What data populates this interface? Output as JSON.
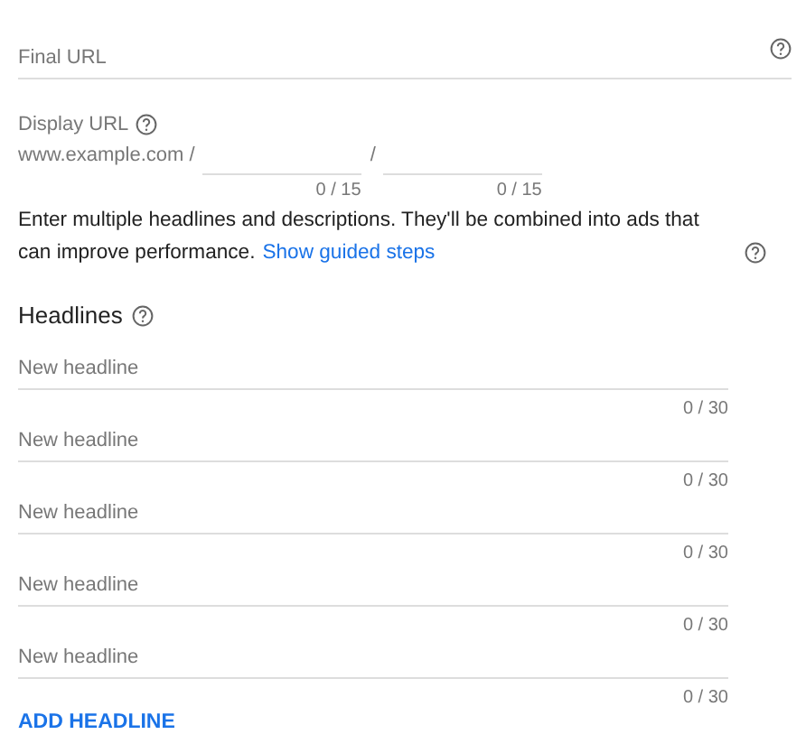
{
  "final_url": {
    "placeholder": "Final URL"
  },
  "display_url": {
    "label": "Display URL",
    "domain": "www.example.com /",
    "separator": "/",
    "paths": [
      {
        "counter": "0 / 15"
      },
      {
        "counter": "0 / 15"
      }
    ]
  },
  "info": {
    "text": "Enter multiple headlines and descriptions. They'll be combined into ads that can improve performance.",
    "link": "Show guided steps"
  },
  "headlines": {
    "title": "Headlines",
    "items": [
      {
        "placeholder": "New headline",
        "counter": "0 / 30"
      },
      {
        "placeholder": "New headline",
        "counter": "0 / 30"
      },
      {
        "placeholder": "New headline",
        "counter": "0 / 30"
      },
      {
        "placeholder": "New headline",
        "counter": "0 / 30"
      },
      {
        "placeholder": "New headline",
        "counter": "0 / 30"
      }
    ],
    "add_button": "ADD HEADLINE"
  }
}
